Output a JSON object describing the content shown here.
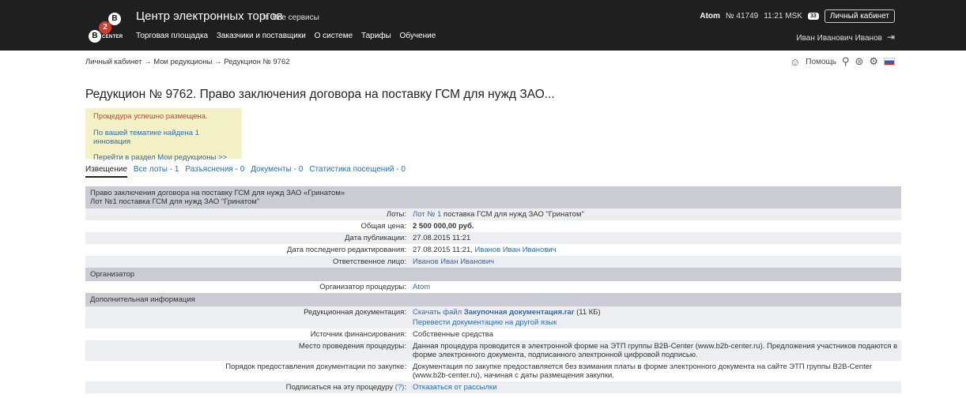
{
  "header": {
    "logo": {
      "b": "B",
      "n": "2",
      "center": "CENTER"
    },
    "title": "Центр электронных торгов",
    "all_services": "Все сервисы",
    "nav": [
      "Торговая площадка",
      "Заказчики и поставщики",
      "О системе",
      "Тарифы",
      "Обучение"
    ],
    "org": "Atom",
    "org_number": "№ 41749",
    "time": "11:21 MSK",
    "messages_badge": "33",
    "cabinet_button": "Личный кабинет",
    "user_name": "Иван Иванович Иванов"
  },
  "breadcrumb": "Личный кабинет → Мои редукционы → Редукцион № 9762",
  "tools": {
    "help": "Помощь"
  },
  "page_title": "Редукцион № 9762. Право заключения договора на поставку ГСМ для нужд ЗАО...",
  "notice": {
    "success": "Процедура успешно размещена.",
    "link1": "По вашей тематике найдена 1 инновация",
    "link2": "Перейти в раздел Мои редукционы >>"
  },
  "tabs": [
    "Извещение",
    "Все лоты - 1",
    "Разъяснения - 0",
    "Документы - 0",
    "Статистика посещений - 0"
  ],
  "table": {
    "heading_line1": "Право заключения договора на поставку ГСМ для нужд ЗАО «Гринатом»",
    "heading_line2": "Лот №1 поставка ГСМ для нужд ЗАО \"Гринатом\"",
    "rows1": [
      {
        "k": "Лоты:",
        "link": "Лот № 1",
        "v": " поставка ГСМ для нужд ЗАО \"Гринатом\""
      },
      {
        "k": "Общая цена:",
        "v": "2 500 000,00 руб."
      },
      {
        "k": "Дата публикации:",
        "v": "27.08.2015 11:21"
      },
      {
        "k": "Дата последнего редактирования:",
        "v": "27.08.2015 11:21, ",
        "link": "Иванов Иван Иванович"
      },
      {
        "k": "Ответственное лицо:",
        "link": "Иванов Иван Иванович"
      }
    ],
    "section_org": "Организатор",
    "org_row": {
      "k": "Организатор процедуры:",
      "link": "Atom"
    },
    "section_extra": "Дополнительная информация",
    "doc_row": {
      "k": "Редукционная документация:",
      "link1": "Скачать файл ",
      "file": "Закупочная документация.rar",
      "size": " (11 КБ)",
      "link2": "Перевести документацию на другой язык"
    },
    "fin_row": {
      "k": "Источник финансирования:",
      "v": "Собственные средства"
    },
    "place_row": {
      "k": "Место проведения процедуры:",
      "v": "Данная процедура проводится в электронной форме на ЭТП группы B2B-Center (www.b2b-center.ru). Предложения участников подаются в форме электронного документа, подписанного электронной цифровой подписью."
    },
    "order_row": {
      "k": "Порядок предоставления документации по закупке:",
      "v": "Документация по закупке предоставляется без взимания платы в форме электронного документа на сайте ЭТП группы B2B-Center (www.b2b-center.ru), начиная с даты размещения закупки."
    },
    "sub_row": {
      "k": "Подписаться на эту процедуру",
      "q": "(?)",
      "link": "Отказаться от рассылки"
    }
  }
}
